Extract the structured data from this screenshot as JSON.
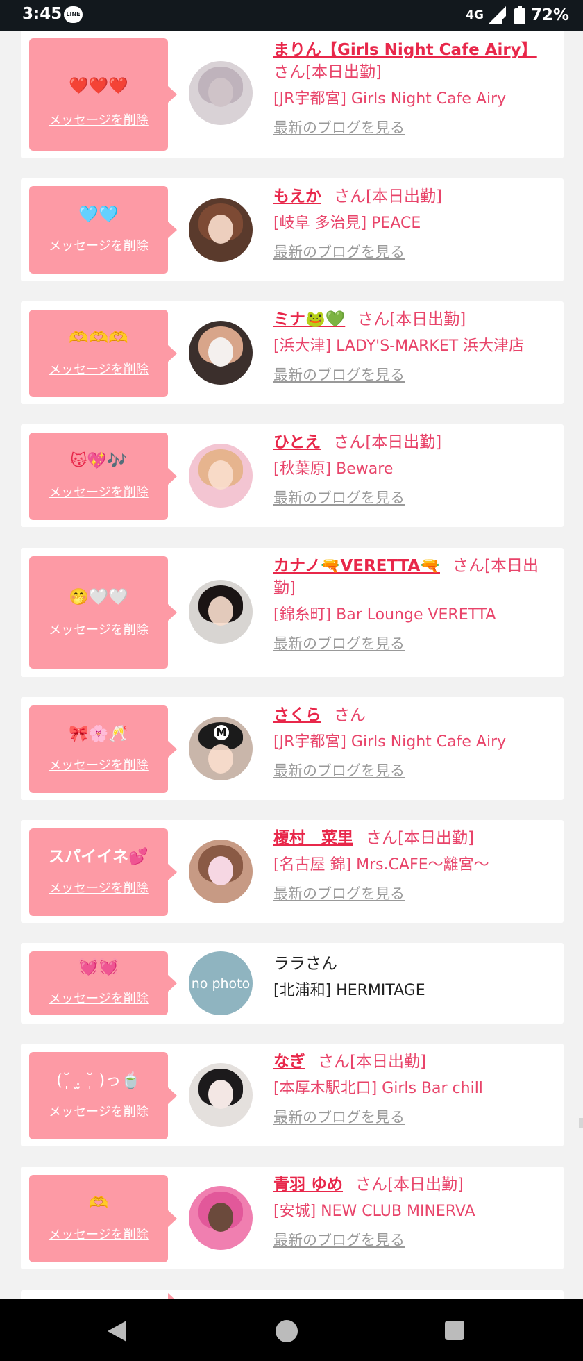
{
  "status_bar": {
    "time": "3:45",
    "app_icon": "line-icon",
    "app_icon_text": "LINE",
    "network": "4G",
    "battery": "72%"
  },
  "delete_label": "メッセージを削除",
  "blog_label": "最新のブログを見る",
  "items": [
    {
      "reaction": "❤️❤️❤️",
      "name": "まりん【Girls Night Cafe Airy】",
      "suffix": "さん[本日出勤]",
      "shop": "[JR宇都宮] Girls Night Cafe Airy"
    },
    {
      "reaction": "🩵🩵",
      "name": "もえか",
      "suffix": "さん[本日出勤]",
      "shop": "[岐阜 多治見] PEACE"
    },
    {
      "reaction": "🫶🫶🫶",
      "name": "ミナ🐸💚",
      "suffix": "さん[本日出勤]",
      "shop": "[浜大津] LADY'S-MARKET 浜大津店"
    },
    {
      "reaction": "😽💖🎶",
      "name": "ひとえ",
      "suffix": "さん[本日出勤]",
      "shop": "[秋葉原] Beware"
    },
    {
      "reaction": "🤭🤍🤍",
      "name": "カナノ🔫VERETTA🔫",
      "suffix": "さん[本日出勤]",
      "shop": "[錦糸町] Bar Lounge VERETTA"
    },
    {
      "reaction": "🎀🌸🥂",
      "name": "さくら",
      "suffix": "さん",
      "shop": "[JR宇都宮] Girls Night Cafe Airy"
    },
    {
      "reaction": "スパイイネ💕",
      "name": "榎村　菜里",
      "suffix": "さん[本日出勤]",
      "shop": "[名古屋 錦] Mrs.CAFE〜離宮〜"
    },
    {
      "reaction": "💓💓",
      "name": "ララさん",
      "suffix": "",
      "shop": "[北浦和] HERMITAGE",
      "avatar_text": "no photo"
    },
    {
      "reaction": "(˘̩̩̩ .̫ ˘̩̩̩ )っ🍵",
      "name": "なぎ",
      "suffix": "さん[本日出勤]",
      "shop": "[本厚木駅北口] Girls Bar chill"
    },
    {
      "reaction": "🫶",
      "name": "青羽 ゆめ",
      "suffix": "さん[本日出勤]",
      "shop": "[安城] NEW CLUB MINERVA"
    }
  ]
}
